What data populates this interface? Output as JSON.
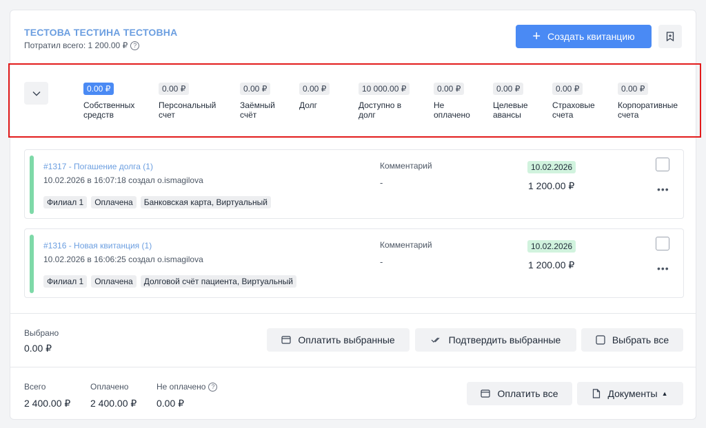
{
  "header": {
    "patient_name": "ТЕСТОВА ТЕСТИНА ТЕСТОВНА",
    "spent_label": "Потратил всего: 1 200.00 ₽",
    "create_button": "Создать квитанцию"
  },
  "balances": [
    {
      "amount": "0.00 ₽",
      "label": "Собственных средств",
      "primary": true
    },
    {
      "amount": "0.00 ₽",
      "label": "Персональный счет"
    },
    {
      "amount": "0.00 ₽",
      "label": "Заёмный счёт"
    },
    {
      "amount": "0.00 ₽",
      "label": "Долг"
    },
    {
      "amount": "10 000.00 ₽",
      "label": "Доступно в долг"
    },
    {
      "amount": "0.00 ₽",
      "label": "Не оплачено"
    },
    {
      "amount": "0.00 ₽",
      "label": "Целевые авансы"
    },
    {
      "amount": "0.00 ₽",
      "label": "Страховые счета"
    },
    {
      "amount": "0.00 ₽",
      "label": "Корпоративные счета"
    }
  ],
  "receipts": [
    {
      "title": "#1317 - Погашение долга (1)",
      "meta": "10.02.2026 в 16:07:18 создал o.ismagilova",
      "tags": [
        "Филиал 1",
        "Оплачена",
        "Банковская карта, Виртуальный"
      ],
      "comment_label": "Комментарий",
      "comment": "-",
      "date": "10.02.2026",
      "sum": "1 200.00 ₽"
    },
    {
      "title": "#1316 - Новая квитанция (1)",
      "meta": "10.02.2026 в 16:06:25 создал o.ismagilova",
      "tags": [
        "Филиал 1",
        "Оплачена",
        "Долговой счёт пациента, Виртуальный"
      ],
      "comment_label": "Комментарий",
      "comment": "-",
      "date": "10.02.2026",
      "sum": "1 200.00 ₽"
    }
  ],
  "selection": {
    "label": "Выбрано",
    "value": "0.00 ₽",
    "pay_selected": "Оплатить выбранные",
    "confirm_selected": "Подтвердить выбранные",
    "select_all": "Выбрать все"
  },
  "totals": {
    "total_label": "Всего",
    "total_value": "2 400.00 ₽",
    "paid_label": "Оплачено",
    "paid_value": "2 400.00 ₽",
    "unpaid_label": "Не оплачено",
    "unpaid_value": "0.00 ₽",
    "pay_all": "Оплатить все",
    "documents": "Документы"
  },
  "colors": {
    "accent": "#4a8af4",
    "status_paid": "#7ed9a8",
    "highlight_border": "#e21a1a"
  }
}
